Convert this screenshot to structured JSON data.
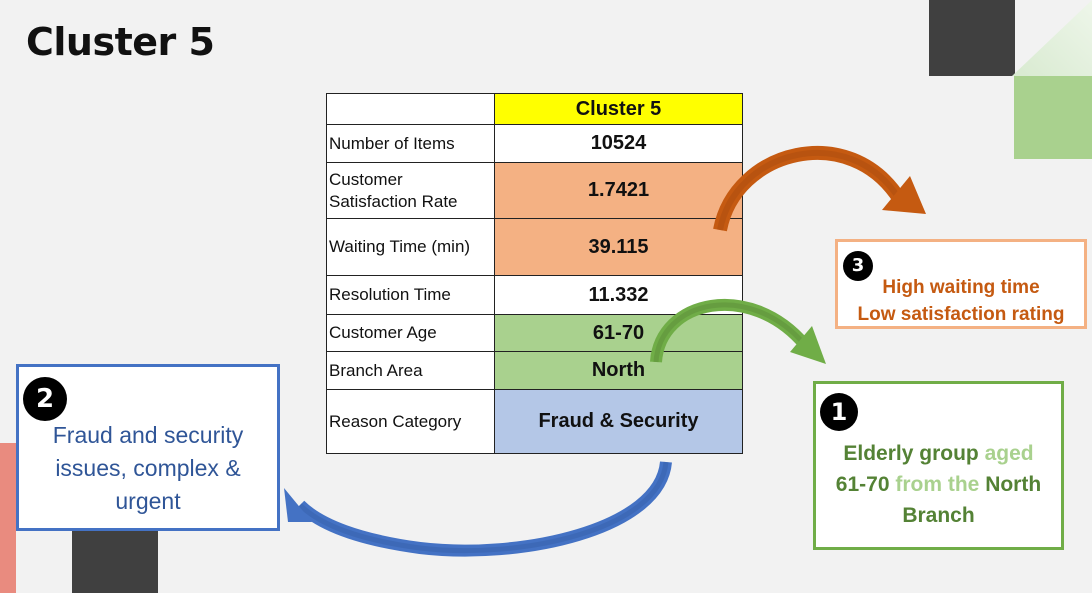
{
  "title": "Cluster 5",
  "table": {
    "header": [
      "",
      "Cluster 5"
    ],
    "rows": [
      {
        "label": "Number of Items",
        "value": "10524",
        "highlight": "none"
      },
      {
        "label": "Customer Satisfaction Rate",
        "value": "1.7421",
        "highlight": "orange"
      },
      {
        "label": "Waiting Time (min)",
        "value": "39.115",
        "highlight": "orange"
      },
      {
        "label": "Resolution Time",
        "value": "11.332",
        "highlight": "none"
      },
      {
        "label": "Customer Age",
        "value": "61-70",
        "highlight": "green"
      },
      {
        "label": "Branch Area",
        "value": "North",
        "highlight": "green"
      },
      {
        "label": "Reason Category",
        "value": "Fraud & Security",
        "highlight": "blue"
      }
    ]
  },
  "callouts": {
    "one": {
      "number": "1",
      "text_a": "Elderly group ",
      "text_b": "aged",
      "text_c": "61-70 ",
      "text_d": "from the ",
      "text_e": "North",
      "text_f": "Branch"
    },
    "two": {
      "number": "2",
      "line1": "Fraud and security",
      "line2": "issues, complex &",
      "line3": "urgent"
    },
    "three": {
      "number": "3",
      "line1": "High waiting time",
      "line2": "Low satisfaction rating"
    }
  },
  "colors": {
    "yellow": "#ffff00",
    "orange": "#f4b183",
    "green": "#a9d18e",
    "blue": "#b4c7e7",
    "arrow_orange": "#c55a11",
    "arrow_green": "#70ad47",
    "arrow_blue": "#4472c4"
  }
}
